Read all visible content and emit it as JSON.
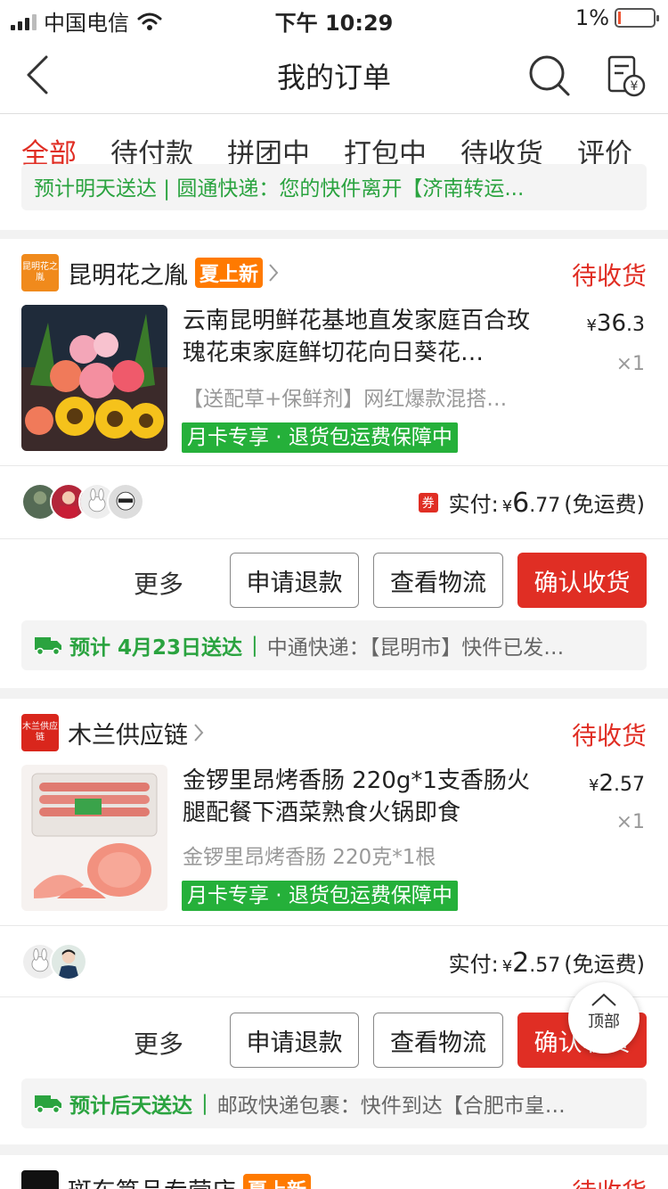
{
  "status_bar": {
    "carrier": "中国电信",
    "time": "下午 10:29",
    "battery": "1%"
  },
  "nav": {
    "title": "我的订单"
  },
  "tabs": [
    {
      "label": "全部",
      "active": true
    },
    {
      "label": "待付款"
    },
    {
      "label": "拼团中"
    },
    {
      "label": "打包中"
    },
    {
      "label": "待收货"
    },
    {
      "label": "评价"
    }
  ],
  "prev_logistics": {
    "text": "预计明天送达 | 圆通快递：您的快件离开【济南转运..."
  },
  "orders": [
    {
      "shop_logo_text": "昆明花之胤",
      "shop_name": "昆明花之胤",
      "shop_tag": "夏上新",
      "status": "待收货",
      "title": "云南昆明鲜花基地直发家庭百合玫瑰花束家庭鲜切花向日葵花…",
      "spec": "【送配草+保鲜剂】网红爆款混搭…",
      "perk": "月卡专享 · 退货包运费保障中",
      "price_symbol": "¥",
      "price_int": "36",
      "price_dec": ".3",
      "qty": "×1",
      "coupon": "券",
      "paid_label": "实付:",
      "paid_symbol": "¥",
      "paid_int": "6",
      "paid_dec": ".77",
      "shipping": "(免运费)",
      "btn_more": "更多",
      "btn_refund": "申请退款",
      "btn_logistics": "查看物流",
      "btn_confirm": "确认收货",
      "eta": "预计 4月23日送达",
      "logistics_sep": "|",
      "logistics_info": "中通快递：【昆明市】快件已发…"
    },
    {
      "shop_logo_text": "木兰供应链",
      "shop_name": "木兰供应链",
      "status": "待收货",
      "title": "金锣里昂烤香肠 220g*1支香肠火腿配餐下酒菜熟食火锅即食",
      "spec": "金锣里昂烤香肠 220克*1根",
      "perk": "月卡专享 · 退货包运费保障中",
      "price_symbol": "¥",
      "price_int": "2",
      "price_dec": ".57",
      "qty": "×1",
      "paid_label": "实付:",
      "paid_symbol": "¥",
      "paid_int": "2",
      "paid_dec": ".57",
      "shipping": "(免运费)",
      "btn_more": "更多",
      "btn_refund": "申请退款",
      "btn_logistics": "查看物流",
      "btn_confirm": "确认收货",
      "eta": "预计后天送达",
      "logistics_sep": "|",
      "logistics_info": "邮政快递包裹：快件到达【合肥市皇…"
    },
    {
      "shop_name": "斑东笃品专营店",
      "shop_tag": "夏上新",
      "status": "待收货"
    }
  ],
  "float_top": {
    "label": "顶部"
  },
  "colors": {
    "accent": "#e02e24",
    "green": "#25b03a",
    "orange": "#ff7a00"
  }
}
